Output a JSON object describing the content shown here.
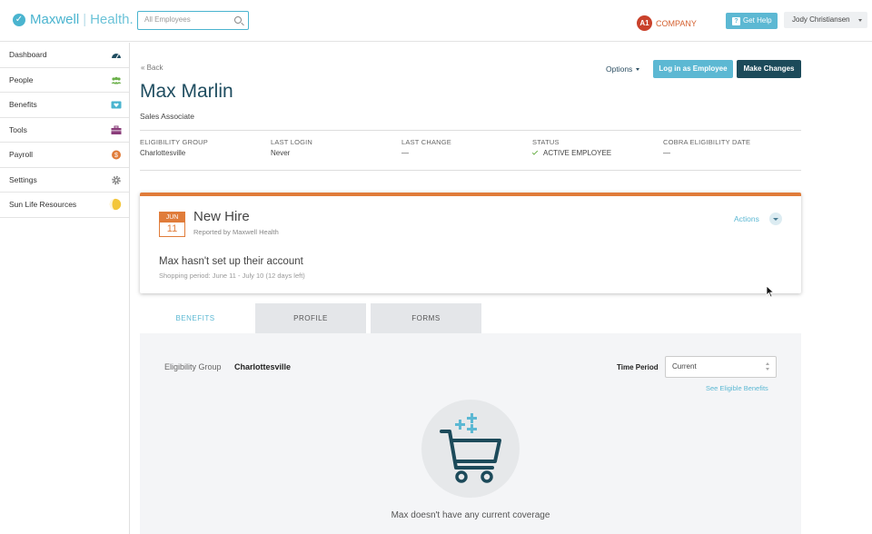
{
  "header": {
    "logo": {
      "brand": "Maxwell",
      "separator": "|",
      "suffix": "Health."
    },
    "search": {
      "placeholder": "All Employees"
    },
    "company": {
      "badge": "A1",
      "name": "COMPANY"
    },
    "help_label": "Get Help",
    "user_name": "Jody Christiansen"
  },
  "sidebar": {
    "items": [
      {
        "label": "Dashboard",
        "icon": "speedometer-icon"
      },
      {
        "label": "People",
        "icon": "people-icon"
      },
      {
        "label": "Benefits",
        "icon": "heart-card-icon"
      },
      {
        "label": "Tools",
        "icon": "toolbox-icon"
      },
      {
        "label": "Payroll",
        "icon": "dollar-coin-icon"
      },
      {
        "label": "Settings",
        "icon": "gear-icon"
      },
      {
        "label": "Sun Life Resources",
        "icon": "sun-life-icon"
      }
    ]
  },
  "page": {
    "back_label": "Back",
    "options_label": "Options",
    "login_as_label": "Log in as Employee",
    "make_changes_label": "Make Changes",
    "employee_name": "Max Marlin",
    "employee_title": "Sales Associate",
    "meta": [
      {
        "label": "ELIGIBILITY GROUP",
        "value": "Charlottesville"
      },
      {
        "label": "LAST LOGIN",
        "value": "Never"
      },
      {
        "label": "LAST CHANGE",
        "value": "—"
      },
      {
        "label": "STATUS",
        "value": "ACTIVE EMPLOYEE"
      },
      {
        "label": "COBRA ELIGIBILITY DATE",
        "value": "—"
      }
    ]
  },
  "event_card": {
    "month": "JUN",
    "day": "11",
    "title": "New Hire",
    "reported_by": "Reported by Maxwell Health",
    "actions_label": "Actions",
    "message": "Max hasn't set up their account",
    "shopping_period": "Shopping period: June 11 - July 10 (12 days left)"
  },
  "tabs": [
    {
      "label": "BENEFITS",
      "active": true
    },
    {
      "label": "PROFILE",
      "active": false
    },
    {
      "label": "FORMS",
      "active": false
    }
  ],
  "benefits_panel": {
    "eligibility_group_label": "Eligibility Group",
    "eligibility_group_value": "Charlottesville",
    "time_period_label": "Time Period",
    "time_period_value": "Current",
    "see_eligible_label": "See Eligible Benefits",
    "empty_message": "Max doesn't have any current coverage"
  },
  "colors": {
    "brand": "#4ab4cf",
    "primary_dark": "#1c4a5a",
    "accent_orange": "#e07c3a",
    "company_red": "#c9412b"
  }
}
